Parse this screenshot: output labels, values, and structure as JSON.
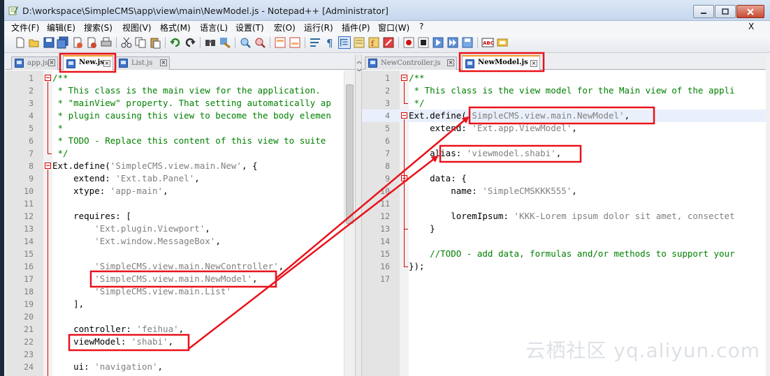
{
  "window": {
    "title": "D:\\workspace\\SimpleCMS\\app\\view\\main\\NewModel.js - Notepad++ [Administrator]",
    "close_x": "X"
  },
  "menu": [
    "文件(F)",
    "编辑(E)",
    "搜索(S)",
    "视图(V)",
    "格式(M)",
    "语言(L)",
    "设置(T)",
    "宏(O)",
    "运行(R)",
    "插件(P)",
    "窗口(W)",
    "?"
  ],
  "toolbar_icons": [
    "new-file-icon",
    "open-file-icon",
    "save-icon",
    "save-all-icon",
    "close-icon",
    "close-all-icon",
    "print-icon",
    "cut-icon",
    "copy-icon",
    "paste-icon",
    "undo-icon",
    "redo-icon",
    "find-icon",
    "replace-icon",
    "zoom-in-icon",
    "zoom-out-icon",
    "sync-v-icon",
    "sync-h-icon",
    "wrap-icon",
    "show-all-icon",
    "indent-guide-icon",
    "doc-map-icon",
    "function-list-icon",
    "folder-workspace-icon",
    "record-icon",
    "stop-icon",
    "play-icon",
    "play-multi-icon",
    "save-macro-icon",
    "spellcheck-icon",
    "spellcheck-settings-icon"
  ],
  "left_tabs": [
    {
      "label": "app.js",
      "active": false
    },
    {
      "label": "New.js",
      "active": true
    },
    {
      "label": "List.js",
      "active": false
    }
  ],
  "right_tabs": [
    {
      "label": "NewController.js",
      "active": false
    },
    {
      "label": "NewModel.js",
      "active": true
    }
  ],
  "left_code": [
    {
      "n": "1",
      "t": "/**"
    },
    {
      "n": "2",
      "t": " * This class is the main view for the application. "
    },
    {
      "n": "3",
      "t": " * \"mainView\" property. That setting automatically ap"
    },
    {
      "n": "4",
      "t": " * plugin causing this view to become the body elemen"
    },
    {
      "n": "5",
      "t": " *"
    },
    {
      "n": "6",
      "t": " * TODO - Replace this content of this view to suite"
    },
    {
      "n": "7",
      "t": " */"
    },
    {
      "n": "8",
      "t": "Ext.define('SimpleCMS.view.main.New', {"
    },
    {
      "n": "9",
      "t": "    extend: 'Ext.tab.Panel',"
    },
    {
      "n": "10",
      "t": "    xtype: 'app-main',"
    },
    {
      "n": "11",
      "t": ""
    },
    {
      "n": "12",
      "t": "    requires: ["
    },
    {
      "n": "13",
      "t": "        'Ext.plugin.Viewport',"
    },
    {
      "n": "14",
      "t": "        'Ext.window.MessageBox',"
    },
    {
      "n": "15",
      "t": ""
    },
    {
      "n": "16",
      "t": "        'SimpleCMS.view.main.NewController',"
    },
    {
      "n": "17",
      "t": "        'SimpleCMS.view.main.NewModel',"
    },
    {
      "n": "18",
      "t": "        'SimpleCMS.view.main.List'"
    },
    {
      "n": "19",
      "t": "    ],"
    },
    {
      "n": "20",
      "t": ""
    },
    {
      "n": "21",
      "t": "    controller: 'feihua',"
    },
    {
      "n": "22",
      "t": "    viewModel: 'shabi',"
    },
    {
      "n": "23",
      "t": ""
    },
    {
      "n": "24",
      "t": "    ui: 'navigation',"
    }
  ],
  "right_code": [
    {
      "n": "1",
      "t": "/**"
    },
    {
      "n": "2",
      "t": " * This class is the view model for the Main view of the appli"
    },
    {
      "n": "3",
      "t": " */"
    },
    {
      "n": "4",
      "t": "Ext.define('SimpleCMS.view.main.NewModel',"
    },
    {
      "n": "5",
      "t": "    extend: 'Ext.app.ViewModel',"
    },
    {
      "n": "6",
      "t": ""
    },
    {
      "n": "7",
      "t": "    alias: 'viewmodel.shabi',"
    },
    {
      "n": "8",
      "t": ""
    },
    {
      "n": "9",
      "t": "    data: {"
    },
    {
      "n": "10",
      "t": "        name: 'SimpleCMSKKK555',"
    },
    {
      "n": "11",
      "t": ""
    },
    {
      "n": "12",
      "t": "        loremIpsum: 'KKK-Lorem ipsum dolor sit amet, consectet"
    },
    {
      "n": "13",
      "t": "    }"
    },
    {
      "n": "14",
      "t": ""
    },
    {
      "n": "15",
      "t": "    //TODO - add data, formulas and/or methods to support your"
    },
    {
      "n": "16",
      "t": "});"
    },
    {
      "n": "17",
      "t": ""
    }
  ],
  "watermark": "云栖社区 yq.aliyun.com",
  "colors": {
    "annotation": "#e8121b",
    "comment": "#008000",
    "string": "#808080",
    "active_tab_top": "#f39a2a"
  }
}
